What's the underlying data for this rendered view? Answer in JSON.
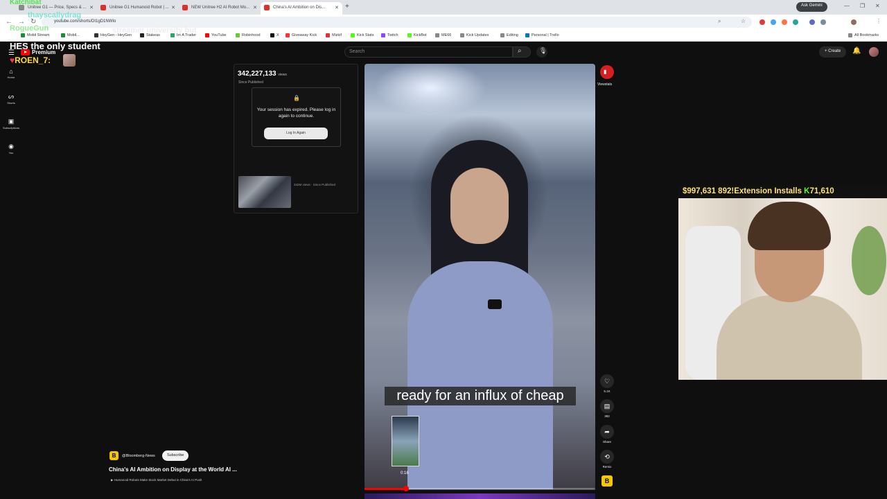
{
  "browser": {
    "tabs": [
      {
        "label": "Unitree G1 — Price, Specs & ..."
      },
      {
        "label": "Unitree G1 Humanoid Robot | ..."
      },
      {
        "label": "NEW Unitree H2 AI Robot Mo..."
      },
      {
        "label": "China's AI Ambition on Dis..."
      }
    ],
    "new_tab": "+",
    "ask_gemini": "Ask Gemini",
    "url": "youtube.com/shorts/DI1gD1NWIo",
    "bookmarks": [
      {
        "label": "Mobil Stream",
        "color": "#1a8c3a"
      },
      {
        "label": "Mobil...",
        "color": "#1a8c3a"
      },
      {
        "label": "HeyGen - HeyGen",
        "color": "#333"
      },
      {
        "label": "Stakeas",
        "color": "#222"
      },
      {
        "label": "Im A Trader",
        "color": "#2a6"
      },
      {
        "label": "YouTube",
        "color": "#f00"
      },
      {
        "label": "Robinhood",
        "color": "#6c3"
      },
      {
        "label": "X",
        "color": "#111"
      },
      {
        "label": "Giveaway Kick",
        "color": "#f33"
      },
      {
        "label": "Mizkif",
        "color": "#d33"
      },
      {
        "label": "Kick Stats",
        "color": "#53fc18"
      },
      {
        "label": "Twitch",
        "color": "#9146ff"
      },
      {
        "label": "KickBot",
        "color": "#53fc18"
      },
      {
        "label": "ME66",
        "color": "#888"
      },
      {
        "label": "Kick Updates",
        "color": "#888"
      },
      {
        "label": "Editing",
        "color": "#888"
      },
      {
        "label": "Personal | Trello",
        "color": "#0079bf"
      }
    ],
    "all_bookmarks": "All Bookmarks"
  },
  "youtube": {
    "logo_text": "Premium",
    "search_placeholder": "Search",
    "create_label": "Create",
    "nav": [
      {
        "label": "Home"
      },
      {
        "label": "Shorts"
      },
      {
        "label": "Subscriptions"
      },
      {
        "label": "You"
      }
    ],
    "viewstats": {
      "views": "342,227,133",
      "views_unit": "views",
      "since": "Since Published",
      "session_message": "Your session has expired. Please log in again to continue.",
      "login_button": "Log In Again",
      "thumb_views": "342M views · Since Published"
    },
    "video": {
      "caption": "ready for an influx of cheap",
      "scrub_time": "0:16",
      "progress": 0.18
    },
    "actions": {
      "viewstats": "Viewstats",
      "like_count": "5.1K",
      "comment_count": "382",
      "share": "Share",
      "remix": "Remix"
    },
    "channel": {
      "badge": "B",
      "name": "@Bloomberg-News",
      "subscribe": "Subscribe",
      "title": "China's AI Ambition on Display at the World AI ...",
      "subtitle": "Humanoid Robots Make Stock Market Debut in China's AI Push"
    }
  },
  "overlay": {
    "line1": "Katchibat",
    "line2": "thayscallydrag",
    "line3": "RogueGun",
    "line3b": "streamer university but",
    "line4": "HES the only student",
    "line5": "ROEN_7:"
  },
  "webcam": {
    "amount": "$997,631",
    "installs": "892!Extension Installs",
    "kick_count": "71,610"
  }
}
